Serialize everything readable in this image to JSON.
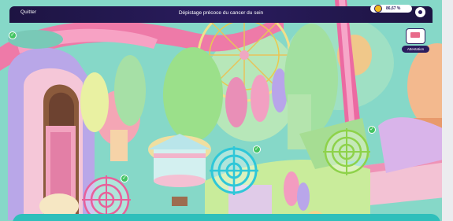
{
  "topbar": {
    "quit_label": "Quitter",
    "title": "Dépistage précoce du cancer du sein",
    "score": "86,67 %",
    "score_icon": "trophy-icon",
    "settings_icon": "gear-icon"
  },
  "attestation": {
    "label": "Attestation",
    "icon": "certificate-icon"
  },
  "targets": [
    {
      "name": "target-1",
      "color": "#e8609a",
      "completed": false
    },
    {
      "name": "target-2",
      "color": "#2fc7d8",
      "completed": true
    },
    {
      "name": "target-3",
      "color": "#8ed24a",
      "completed": true
    },
    {
      "name": "target-4",
      "color": "#e8609a",
      "completed": true
    }
  ],
  "colors": {
    "bar": "#1d1442",
    "accent_teal": "#2fbfbb",
    "check_green": "#43c462"
  }
}
